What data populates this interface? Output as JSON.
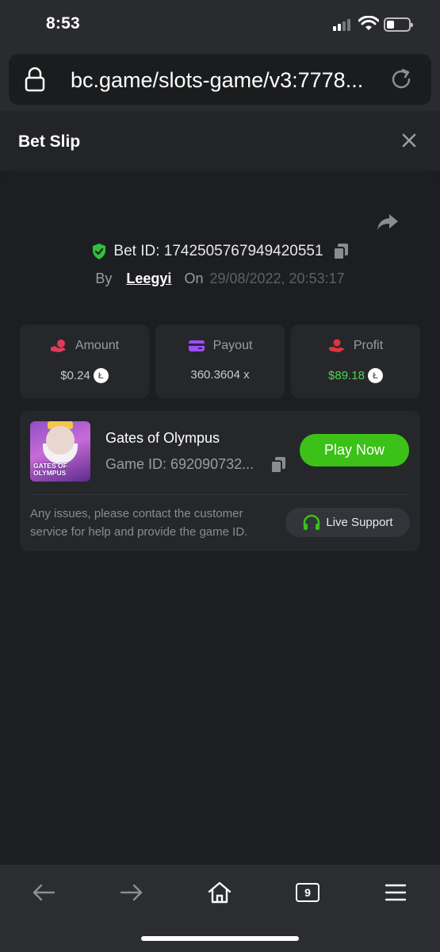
{
  "status_bar": {
    "time": "8:53"
  },
  "browser": {
    "url": "bc.game/slots-game/v3:7778..."
  },
  "bet_slip": {
    "title": "Bet Slip",
    "bet_id_label": "Bet ID: 1742505767949420551",
    "by_label": "By",
    "username": "Leegyi",
    "on_label": "On",
    "date": "29/08/2022, 20:53:17",
    "stats": [
      {
        "label": "Amount",
        "value": "$0.24",
        "icon": "amount-icon",
        "color": "#e23b5a"
      },
      {
        "label": "Payout",
        "value": "360.3604 x",
        "icon": "payout-icon",
        "color": "#9b4ff5"
      },
      {
        "label": "Profit",
        "value": "$89.18",
        "icon": "profit-icon",
        "color": "#e0343d"
      }
    ],
    "coin_symbol": "Ł"
  },
  "game": {
    "thumbnail_text": "GATES OF OLYMPUS",
    "name": "Gates of Olympus",
    "game_id": "Game ID: 692090732...",
    "play_label": "Play Now",
    "help_text": "Any issues, please contact the customer service for help and provide the game ID.",
    "support_label": "Live Support"
  },
  "toolbar": {
    "tabs_count": "9"
  },
  "colors": {
    "accent_green": "#3bc117",
    "profit_green": "#4bd44b"
  }
}
